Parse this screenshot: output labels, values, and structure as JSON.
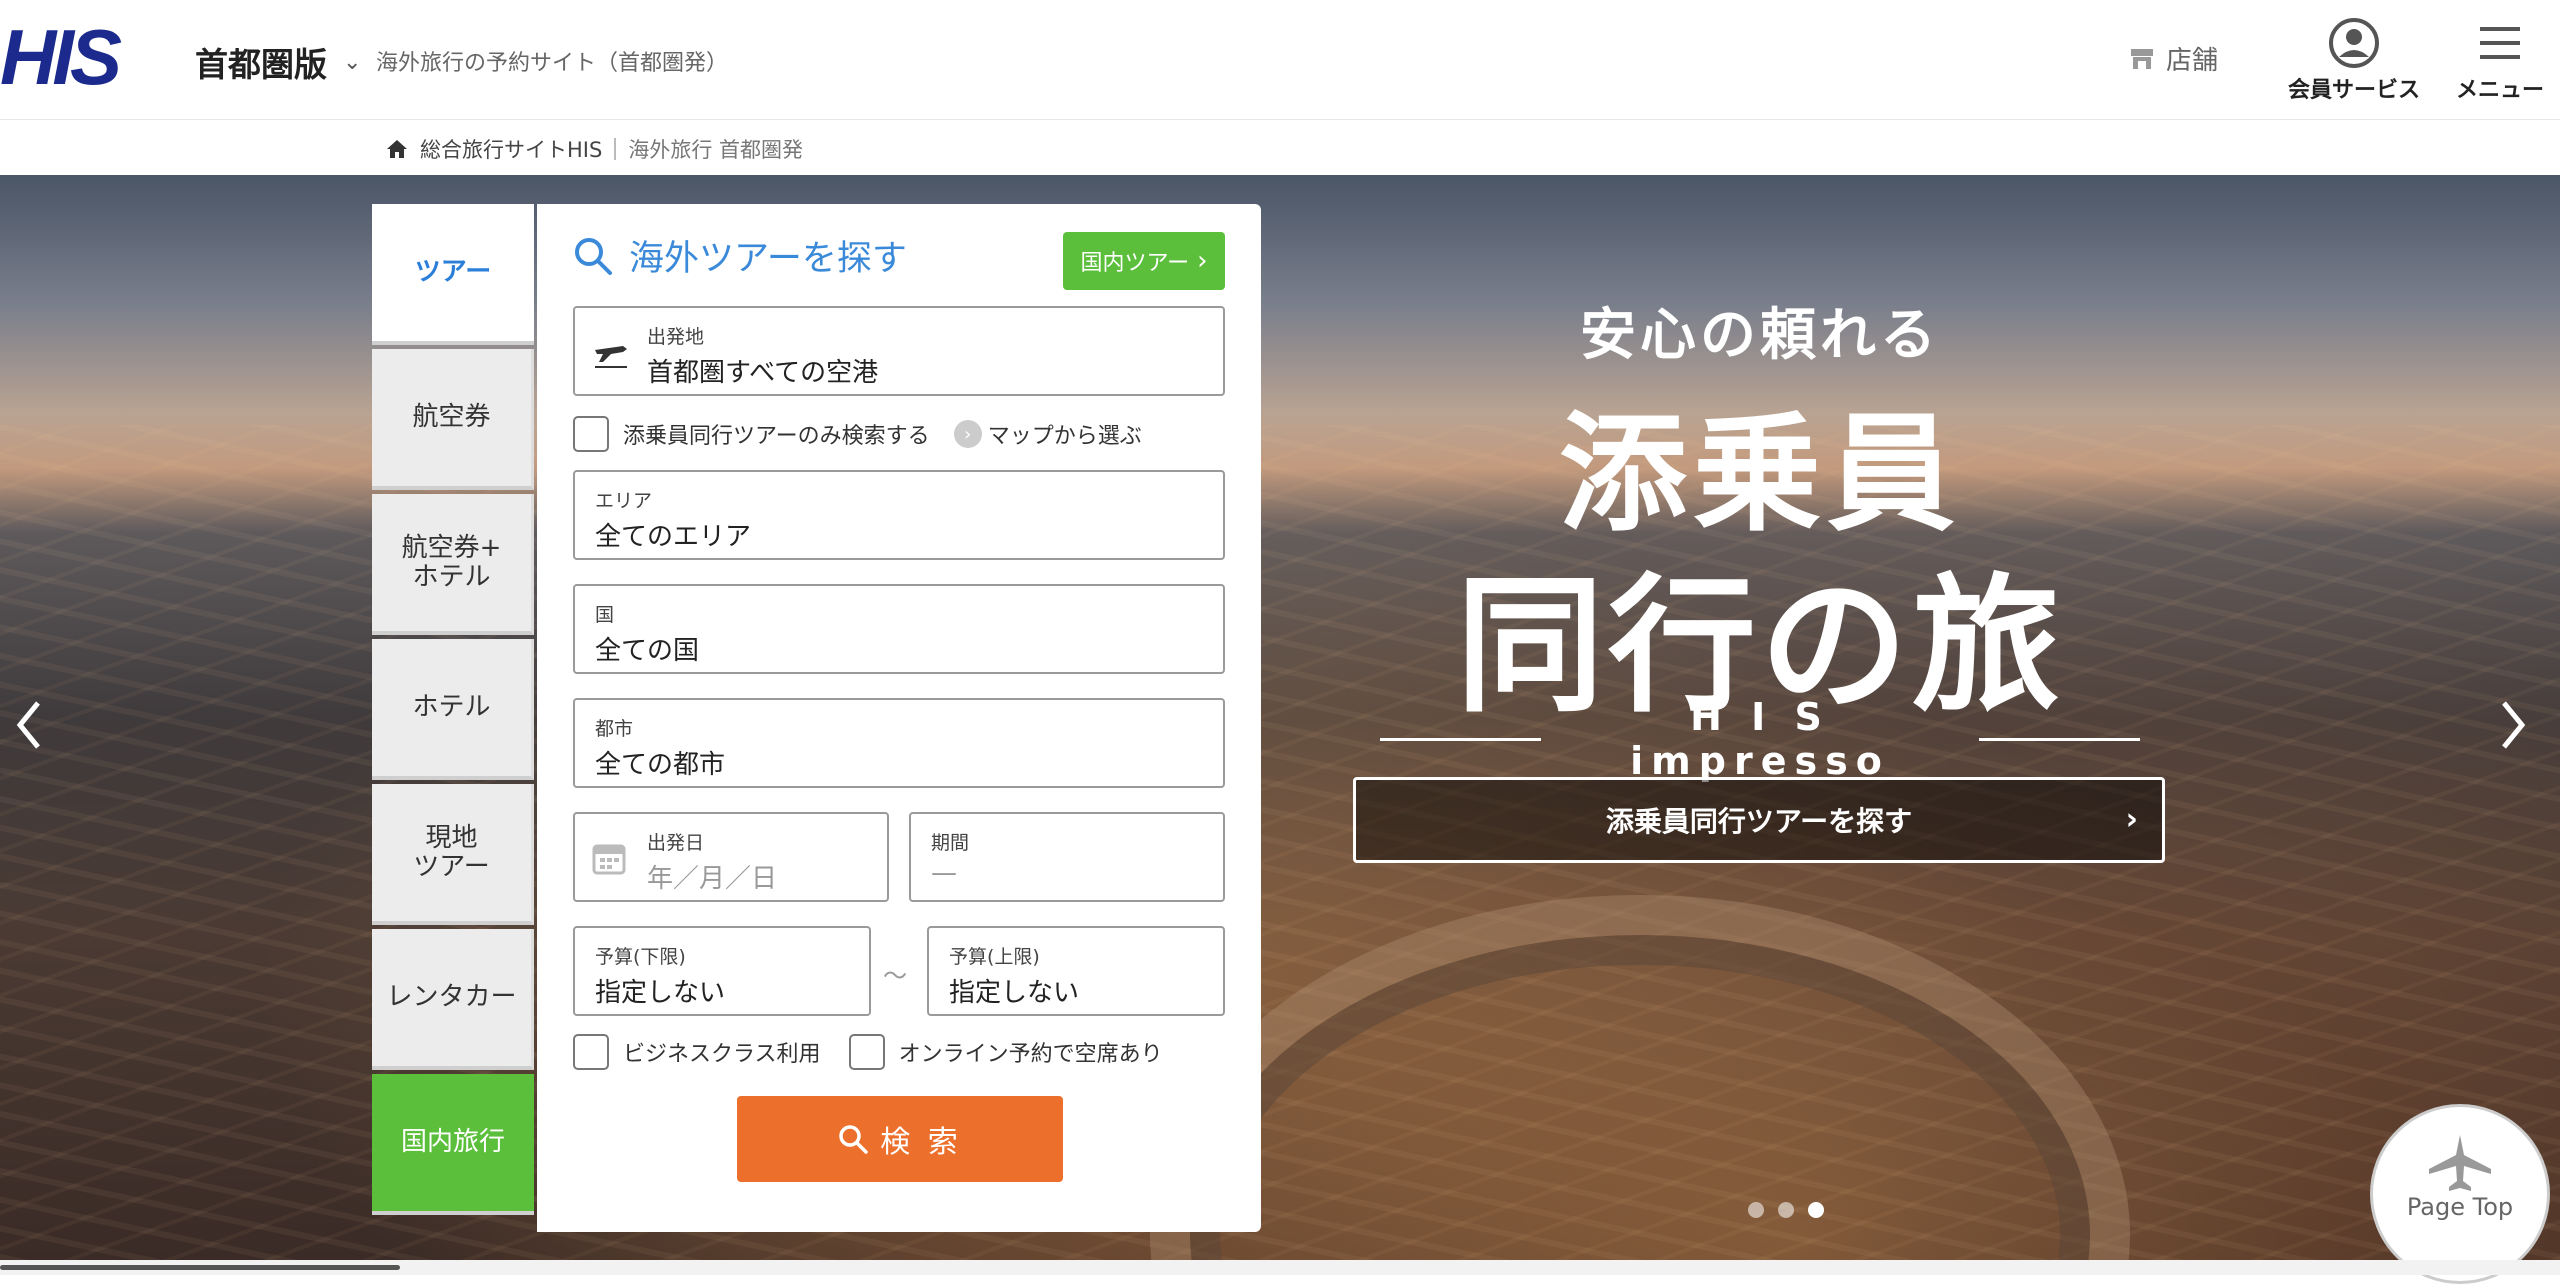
{
  "header": {
    "logo_text": "HIS",
    "region": "首都圏版",
    "tagline": "海外旅行の予約サイト（首都圏発）",
    "store_label": "店舗",
    "member_label": "会員サービス",
    "menu_label": "メニュー"
  },
  "breadcrumb": {
    "home": "総合旅行サイトHIS",
    "current": "海外旅行 首都圏発"
  },
  "tabs": [
    {
      "label": "ツアー"
    },
    {
      "label": "航空券"
    },
    {
      "label": "航空券+\nホテル"
    },
    {
      "label": "ホテル"
    },
    {
      "label": "現地\nツアー"
    },
    {
      "label": "レンタカー"
    },
    {
      "label": "国内旅行"
    }
  ],
  "search": {
    "title": "海外ツアーを探す",
    "domestic_button": "国内ツアー",
    "departure": {
      "label": "出発地",
      "value": "首都圏すべての空港"
    },
    "conductor_only": "添乗員同行ツアーのみ検索する",
    "map_link": "マップから選ぶ",
    "area": {
      "label": "エリア",
      "value": "全てのエリア"
    },
    "country": {
      "label": "国",
      "value": "全ての国"
    },
    "city": {
      "label": "都市",
      "value": "全ての都市"
    },
    "date": {
      "label": "出発日",
      "placeholder": "年／月／日"
    },
    "duration": {
      "label": "期間",
      "value": "—"
    },
    "budget_min": {
      "label": "予算(下限)",
      "value": "指定しない"
    },
    "budget_tilde": "～",
    "budget_max": {
      "label": "予算(上限)",
      "value": "指定しない"
    },
    "business_class": "ビジネスクラス利用",
    "online_available": "オンライン予約で空席あり",
    "search_button": "検 索"
  },
  "hero": {
    "subtitle": "安心の頼れる",
    "main_line1": "添乗員",
    "main_line2": "同行の旅",
    "brand": "H I S  impresso",
    "cta": "添乗員同行ツアーを探す",
    "slide_count": 3,
    "active_slide": 3
  },
  "page_top": "Page Top"
}
